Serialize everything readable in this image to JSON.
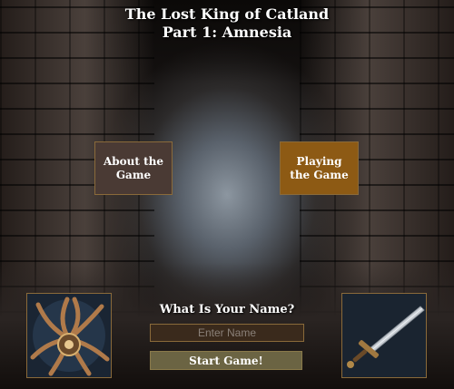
{
  "game": {
    "title_line1": "The Lost King of Catland",
    "title_line2": "Part 1: Amnesia"
  },
  "menu": {
    "about_label": "About the Game",
    "playing_label": "Playing the Game"
  },
  "name_form": {
    "prompt": "What Is Your Name?",
    "placeholder": "Enter Name",
    "start_label": "Start Game!"
  },
  "images": {
    "left_icon": "tentacle-artifact-icon",
    "right_icon": "sword-icon"
  },
  "colors": {
    "about_bg": "#4a3a34",
    "playing_bg": "#8d5a14",
    "start_bg": "#6b6443",
    "border": "#8a6a3a"
  }
}
